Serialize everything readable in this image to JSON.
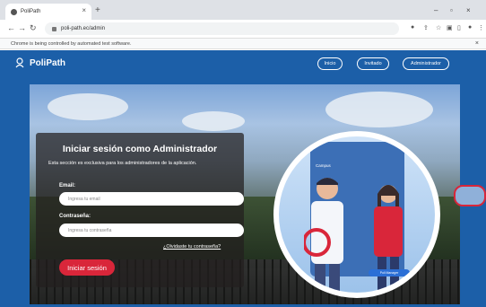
{
  "browser": {
    "tab_title": "PoliPath",
    "tab_close": "×",
    "new_tab": "+",
    "url": "poli-path.ec/admin",
    "automation_notice": "Chrome is being controlled by automated test software.",
    "notice_close": "×",
    "window_controls": [
      "–",
      "▫",
      "×"
    ]
  },
  "navbar": {
    "brand": "PoliPath",
    "links": [
      "Inicio",
      "Invitado",
      "Administrador"
    ]
  },
  "login": {
    "title": "Iniciar sesión como Administrador",
    "description": "Esta sección es exclusiva para los administradores de la aplicación.",
    "email_label": "Email:",
    "email_placeholder": "Ingresa tu email",
    "password_label": "Contraseña:",
    "password_placeholder": "Ingresa tu contraseña",
    "forgot": "¿Olvidaste tu contraseña?",
    "submit": "Iniciar sesión"
  },
  "illustration": {
    "phone_text": "Campus",
    "badge": "Poli Manager"
  },
  "colors": {
    "nav_bg": "#1c5fa8",
    "accent": "#d9263a"
  }
}
